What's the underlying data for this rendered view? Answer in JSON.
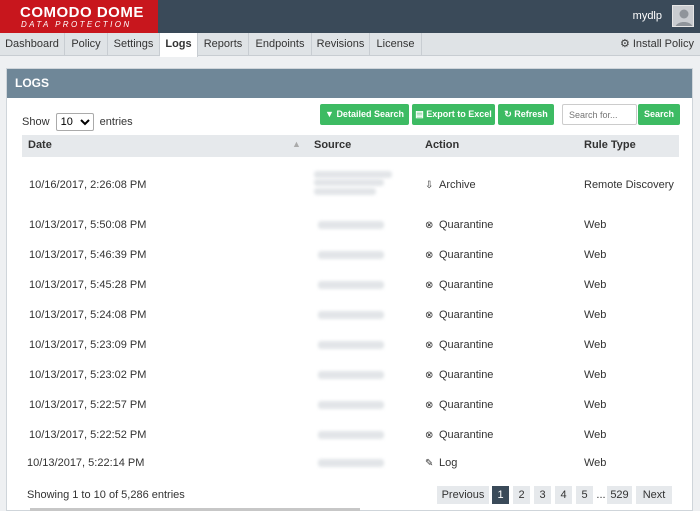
{
  "brand": {
    "line1": "COMODO DOME",
    "line2": "DATA PROTECTION"
  },
  "user": {
    "name": "mydlp"
  },
  "nav": {
    "items": [
      "Dashboard",
      "Policy",
      "Settings",
      "Logs",
      "Reports",
      "Endpoints",
      "Revisions",
      "License"
    ],
    "active": "Logs",
    "install_policy": "Install Policy"
  },
  "panel": {
    "title": "LOGS"
  },
  "controls": {
    "show_label": "Show",
    "entries_value": "10",
    "entries_label": "entries",
    "detailed_search": "Detailed Search",
    "export_excel": "Export to Excel",
    "refresh": "Refresh",
    "search_placeholder": "Search for...",
    "search_button": "Search"
  },
  "table": {
    "columns": [
      "Date",
      "Source",
      "Action",
      "Rule Type"
    ],
    "rows": [
      {
        "date": "10/16/2017, 2:26:08 PM",
        "action": "Archive",
        "action_icon": "archive-icon",
        "rule_type": "Remote Discovery"
      },
      {
        "date": "10/13/2017, 5:50:08 PM",
        "action": "Quarantine",
        "action_icon": "quarantine-icon",
        "rule_type": "Web"
      },
      {
        "date": "10/13/2017, 5:46:39 PM",
        "action": "Quarantine",
        "action_icon": "quarantine-icon",
        "rule_type": "Web"
      },
      {
        "date": "10/13/2017, 5:45:28 PM",
        "action": "Quarantine",
        "action_icon": "quarantine-icon",
        "rule_type": "Web"
      },
      {
        "date": "10/13/2017, 5:24:08 PM",
        "action": "Quarantine",
        "action_icon": "quarantine-icon",
        "rule_type": "Web"
      },
      {
        "date": "10/13/2017, 5:23:09 PM",
        "action": "Quarantine",
        "action_icon": "quarantine-icon",
        "rule_type": "Web"
      },
      {
        "date": "10/13/2017, 5:23:02 PM",
        "action": "Quarantine",
        "action_icon": "quarantine-icon",
        "rule_type": "Web"
      },
      {
        "date": "10/13/2017, 5:22:57 PM",
        "action": "Quarantine",
        "action_icon": "quarantine-icon",
        "rule_type": "Web"
      },
      {
        "date": "10/13/2017, 5:22:52 PM",
        "action": "Quarantine",
        "action_icon": "quarantine-icon",
        "rule_type": "Web"
      },
      {
        "date": "10/13/2017, 5:22:14 PM",
        "action": "Log",
        "action_icon": "pencil-icon",
        "rule_type": "Web"
      }
    ]
  },
  "footer": {
    "summary": "Showing 1 to 10 of 5,286 entries",
    "pagination": {
      "previous": "Previous",
      "pages": [
        "1",
        "2",
        "3",
        "4",
        "5"
      ],
      "ellipsis": "...",
      "last": "529",
      "next": "Next",
      "current": "1"
    }
  },
  "colors": {
    "topbar": "#3a4a59",
    "brand": "#c8161d",
    "panel_header": "#6f8798",
    "accent_green": "#3dbb63"
  }
}
